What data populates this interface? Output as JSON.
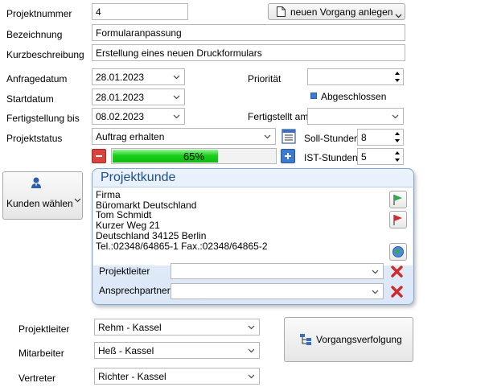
{
  "form": {
    "projektnummer": {
      "label": "Projektnummer",
      "value": "4"
    },
    "new_case_button": "neuen Vorgang anlegen",
    "bezeichnung": {
      "label": "Bezeichnung",
      "value": "Formularanpassung"
    },
    "kurzbeschreibung": {
      "label": "Kurzbeschreibung",
      "value": "Erstellung eines neuen Druckformulars"
    },
    "anfragedatum": {
      "label": "Anfragedatum",
      "value": "28.01.2023"
    },
    "prioritaet": {
      "label": "Priorität",
      "value": ""
    },
    "startdatum": {
      "label": "Startdatum",
      "value": "28.01.2023"
    },
    "abgeschlossen": {
      "label": "Abgeschlossen",
      "checked": false
    },
    "fertigstellung_bis": {
      "label": "Fertigstellung bis",
      "value": "08.02.2023"
    },
    "fertiggestellt_am": {
      "label": "Fertigstellt am",
      "value": ""
    },
    "projektstatus": {
      "label": "Projektstatus",
      "value": "Auftrag erhalten"
    },
    "soll_stunden": {
      "label": "Soll-Stunden",
      "value": "8"
    },
    "ist_stunden": {
      "label": "IST-Stunden",
      "value": "5"
    },
    "progress": {
      "percent": 65,
      "text": "65%"
    }
  },
  "customer_button": "Kunden wählen",
  "panel": {
    "title": "Projektkunde",
    "address_lines": [
      "Firma",
      "Büromarkt Deutschland",
      "Tom Schmidt",
      "Kurzer Weg 21",
      "Deutschland 34125 Berlin",
      "Tel.:02348/64865-1  Fax.:02348/64865-2"
    ],
    "projektleiter": {
      "label": "Projektleiter",
      "value": ""
    },
    "ansprechpartner": {
      "label": "Ansprechpartner",
      "value": ""
    }
  },
  "bottom": {
    "projektleiter": {
      "label": "Projektleiter",
      "value": "Rehm - Kassel"
    },
    "mitarbeiter": {
      "label": "Mitarbeiter",
      "value": "Heß - Kassel"
    },
    "vertreter": {
      "label": "Vertreter",
      "value": "Richter - Kassel"
    },
    "tracking_button": "Vorgangsverfolgung"
  },
  "colors": {
    "progress_green": "#19d219",
    "panel_border": "#7fa7d6",
    "panel_title": "#1f4e8c",
    "minus_red": "#d9433b",
    "plus_blue": "#3b7bd4",
    "delete_red": "#d02b2b"
  }
}
